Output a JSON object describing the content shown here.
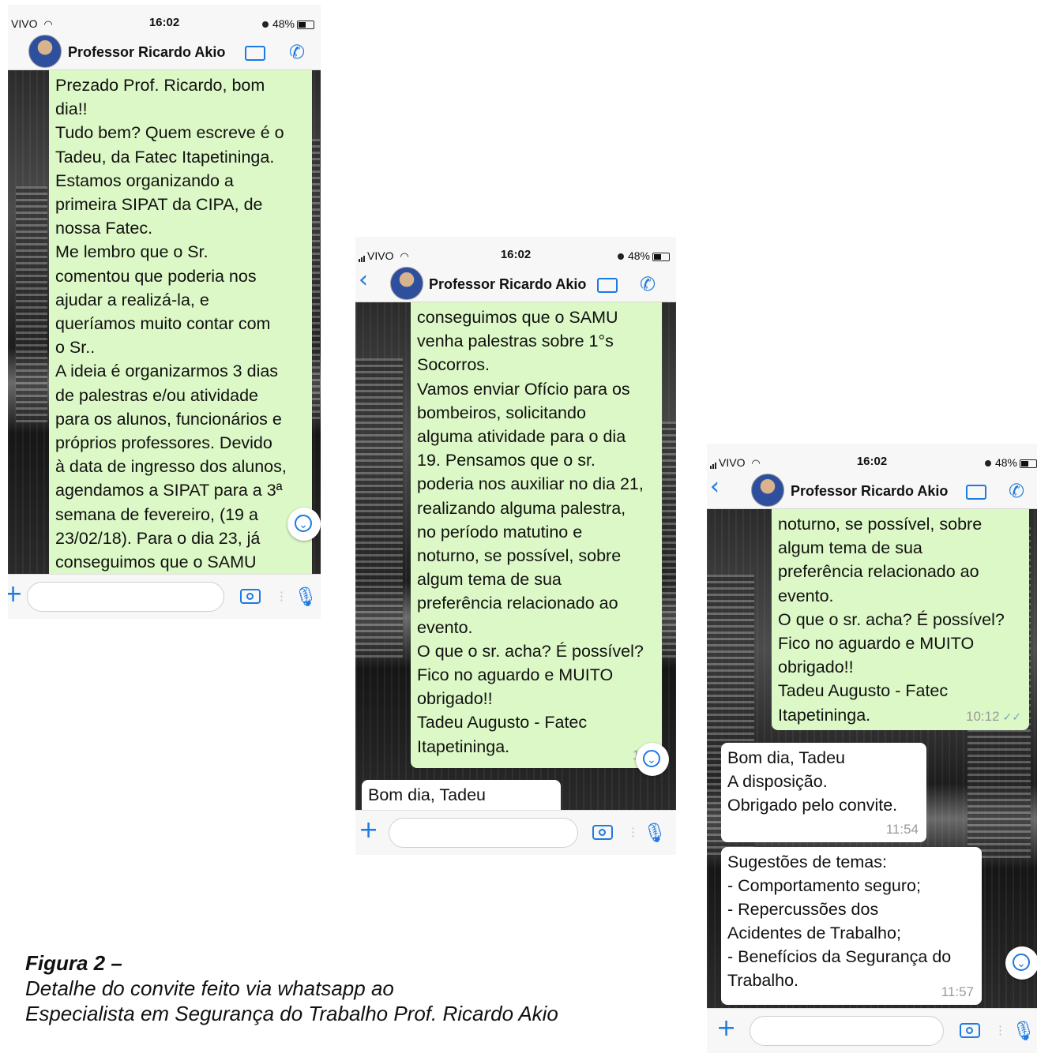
{
  "status": {
    "carrier": "VIVO",
    "time": "16:02",
    "battery": "48%"
  },
  "contact": {
    "name": "Professor Ricardo Akio"
  },
  "screens": [
    {
      "outgoing": "Prezado Prof. Ricardo, bom\ndia!!\nTudo bem? Quem escreve é o\nTadeu, da Fatec Itapetininga.\nEstamos organizando a\nprimeira SIPAT da CIPA, de\nnossa Fatec.\nMe lembro que o Sr.\ncomentou que poderia nos\najudar a realizá-la, e\nqueríamos muito contar com\no Sr..\nA ideia é organizarmos 3 dias\nde palestras e/ou atividade\npara os alunos, funcionários e\npróprios professores. Devido\nà data de ingresso dos alunos,\nagendamos a SIPAT para a 3ª\nsemana de fevereiro,  (19 a\n23/02/18). Para o dia 23, já\nconseguimos que o SAMU"
    },
    {
      "outgoing": "conseguimos que o SAMU\nvenha palestras sobre 1°s\nSocorros.\nVamos enviar Ofício para os\nbombeiros, solicitando\nalguma atividade para o dia\n19. Pensamos que o sr.\npoderia nos auxiliar no dia 21,\nrealizando alguma palestra,\nno período matutino e\nnoturno, se possível, sobre\nalgum tema de sua\npreferência relacionado ao\nevento.\nO que o sr. acha?  É possível?\nFico no aguardo e MUITO\nobrigado!!\nTadeu Augusto - Fatec\nItapetininga.",
      "outgoing_time": "10:1",
      "incoming": "Bom dia, Tadeu"
    },
    {
      "outgoing": "noturno, se possível, sobre\nalgum tema de sua\npreferência relacionado ao\nevento.\nO que o sr. acha?  É possível?\nFico no aguardo e MUITO\nobrigado!!\nTadeu Augusto - Fatec\nItapetininga.",
      "outgoing_time": "10:12",
      "reply1": "Bom dia, Tadeu\nA disposição.\nObrigado pelo convite.",
      "reply1_time": "11:54",
      "reply2": "Sugestões de temas:\n- Comportamento seguro;\n- Repercussões dos\nAcidentes de Trabalho;\n- Benefícios da Segurança do\nTrabalho.",
      "reply2_time": "11:57"
    }
  ],
  "caption": {
    "label": "Figura 2 –",
    "line1": "Detalhe do convite feito via whatsapp ao",
    "line2": "Especialista em Segurança do Trabalho Prof. Ricardo Akio"
  },
  "icons": {
    "back": "chevron-left-icon",
    "video": "video-camera-icon",
    "call": "phone-icon",
    "attach": "plus-icon",
    "camera": "camera-icon",
    "mic": "microphone-icon",
    "scroll": "chevron-down-icon"
  },
  "colors": {
    "accent": "#1e7ae0",
    "outgoing_bubble": "#dcf8c6",
    "incoming_bubble": "#ffffff"
  }
}
